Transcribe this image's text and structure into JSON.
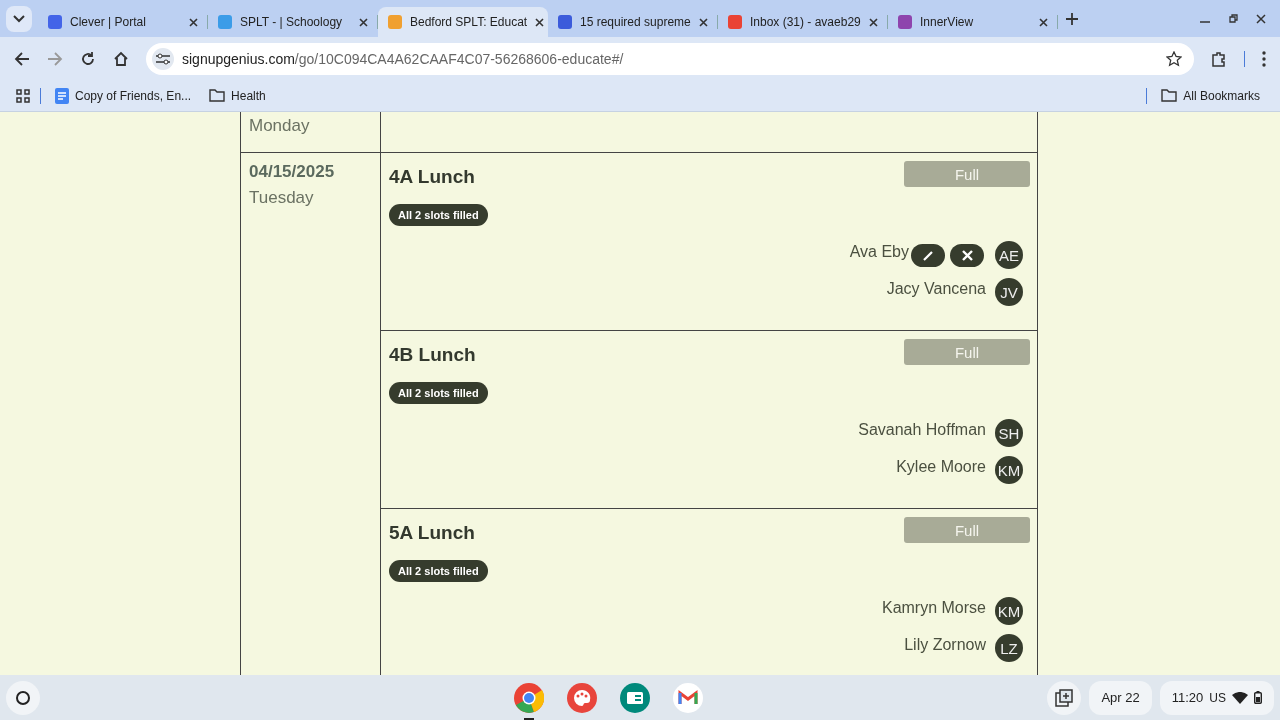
{
  "browser": {
    "tabs": [
      {
        "title": "Clever | Portal",
        "selected": false,
        "color": "#4364e8"
      },
      {
        "title": "SPLT - | Schoology",
        "selected": false,
        "color": "#3b9ce8"
      },
      {
        "title": "Bedford SPLT: Educat",
        "selected": true,
        "color": "#f0a030"
      },
      {
        "title": "15 required supreme",
        "selected": false,
        "color": "#3b5bdb"
      },
      {
        "title": "Inbox (31) - avaeb29",
        "selected": false,
        "color": "#ea4335"
      },
      {
        "title": "InnerView",
        "selected": false,
        "color": "#8e44ad"
      }
    ],
    "url": {
      "host": "signupgenius.com",
      "path": "/go/10C094CA4A62CAAF4C07-56268606-educate#/"
    },
    "bookmarks": [
      {
        "kind": "doc",
        "label": "Copy of Friends, En..."
      },
      {
        "kind": "folder",
        "label": "Health"
      }
    ],
    "all_bookmarks": "All Bookmarks"
  },
  "schedule": {
    "previous_day": "Monday",
    "day": {
      "date": "04/15/2025",
      "weekday": "Tuesday",
      "slots": [
        {
          "title": "4A Lunch",
          "status": "Full",
          "badge": "All 2 slots filled",
          "signups": [
            {
              "name": "Ava Eby",
              "initials": "AE",
              "actions": [
                {
                  "kind": "edit"
                },
                {
                  "kind": "delete"
                }
              ]
            },
            {
              "name": "Jacy Vancena",
              "initials": "JV"
            }
          ]
        },
        {
          "title": "4B Lunch",
          "status": "Full",
          "badge": "All 2 slots filled",
          "signups": [
            {
              "name": "Savanah Hoffman",
              "initials": "SH"
            },
            {
              "name": "Kylee Moore",
              "initials": "KM"
            }
          ]
        },
        {
          "title": "5A Lunch",
          "status": "Full",
          "badge": "All 2 slots filled",
          "signups": [
            {
              "name": "Kamryn Morse",
              "initials": "KM"
            },
            {
              "name": "Lily Zornow",
              "initials": "LZ"
            }
          ]
        }
      ]
    }
  },
  "taskbar": {
    "date": "Apr 22",
    "time": "11:20",
    "locale": "US"
  }
}
